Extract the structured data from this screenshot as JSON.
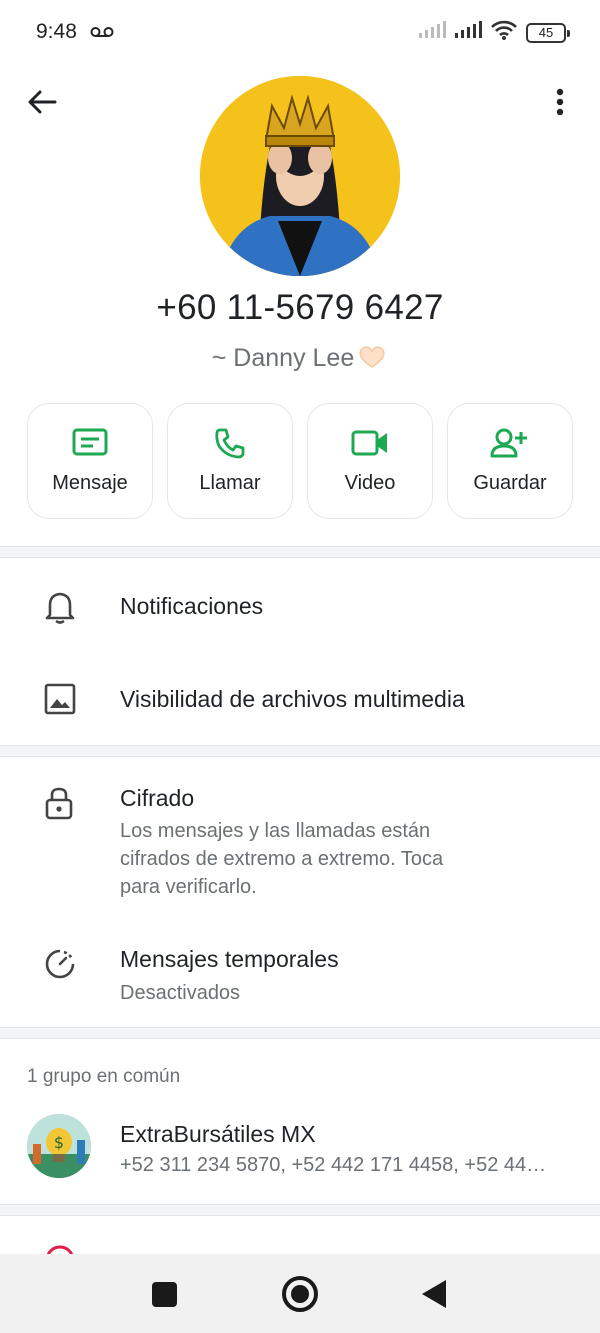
{
  "status_bar": {
    "time": "9:48",
    "battery": "45",
    "icons": [
      "voicemail-icon",
      "signal-icon",
      "signal-icon",
      "wifi-icon",
      "battery-icon"
    ]
  },
  "top_bar": {
    "icons": [
      "back-arrow-icon",
      "more-vert-icon"
    ]
  },
  "profile": {
    "phone": "+60 11-5679 6427",
    "name": "~ Danny Lee",
    "name_emoji": "heart-hands-emoji"
  },
  "actions": [
    {
      "label": "Mensaje",
      "icon": "message-icon"
    },
    {
      "label": "Llamar",
      "icon": "phone-icon"
    },
    {
      "label": "Video",
      "icon": "video-icon"
    },
    {
      "label": "Guardar",
      "icon": "add-person-icon"
    }
  ],
  "settings": {
    "notifications": {
      "title": "Notificaciones",
      "icon": "bell-icon"
    },
    "media_visibility": {
      "title": "Visibilidad de archivos multimedia",
      "icon": "image-icon"
    },
    "encryption": {
      "title": "Cifrado",
      "lines": [
        "Los mensajes y las llamadas están",
        "cifrados de extremo a extremo. Toca",
        "para verificarlo."
      ],
      "icon": "lock-icon"
    },
    "disappearing": {
      "title": "Mensajes temporales",
      "subtitle": "Desactivados",
      "icon": "timer-icon"
    }
  },
  "groups": {
    "header": "1 grupo en común",
    "items": [
      {
        "name": "ExtraBursátiles MX",
        "members": "+52 311 234 5870, +52 442 171 4458, +52 44…"
      }
    ]
  },
  "colors": {
    "accent": "#1da851",
    "text": "#1f2328",
    "muted": "#6b7075",
    "divider": "#f2f4f5",
    "danger": "#e11d48"
  },
  "nav_bar": {
    "icons": [
      "recent-apps-icon",
      "home-icon",
      "back-triangle-icon"
    ]
  }
}
